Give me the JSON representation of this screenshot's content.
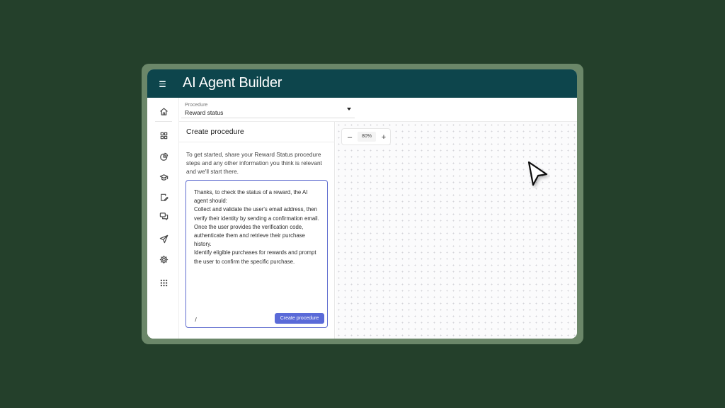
{
  "app": {
    "title": "AI Agent Builder"
  },
  "header": {
    "menu_icon": "hamburger-menu-icon"
  },
  "rail": {
    "items": [
      {
        "icon": "home-icon"
      },
      {
        "icon": "grid-apps-icon"
      },
      {
        "icon": "pie-chart-icon"
      },
      {
        "icon": "graduation-cap-icon"
      },
      {
        "icon": "document-edit-icon"
      },
      {
        "icon": "chat-bubbles-icon"
      },
      {
        "icon": "send-icon"
      },
      {
        "icon": "gear-icon"
      },
      {
        "icon": "dots-grid-icon"
      }
    ]
  },
  "procedure_select": {
    "label": "Procedure",
    "value": "Reward status"
  },
  "panel": {
    "title": "Create procedure",
    "intro": "To get started, share your Reward Status procedure steps and any other information you think is relevant and we'll start there.",
    "editor_lines": [
      "Thanks, to check the status of a reward, the AI agent should:",
      "Collect and validate the user's email address, then verify their identity by sending a confirmation email.",
      "Once the user provides the verification code, authenticate them and retrieve their purchase history.",
      "Identify eligible purchases for rewards and prompt the user to confirm the specific purchase."
    ],
    "slash_label": "/",
    "create_button": "Create procedure"
  },
  "canvas": {
    "zoom_out": "–",
    "zoom_level": "80%",
    "zoom_in": "+"
  },
  "colors": {
    "background": "#24402b",
    "header": "#0d454c",
    "accent": "#5a6ad8",
    "editor_border": "#5f6ccf"
  }
}
